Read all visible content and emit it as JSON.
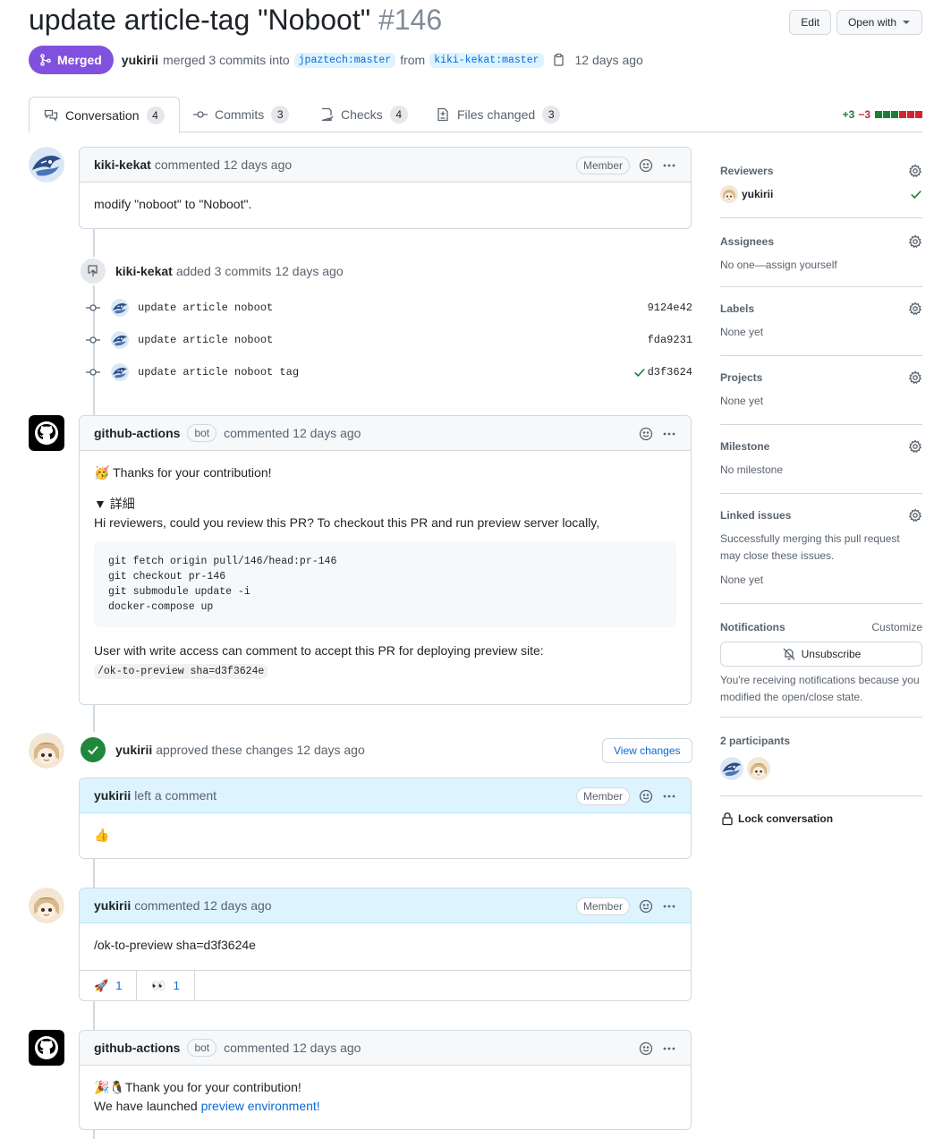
{
  "pr": {
    "title": "update article-tag \"Noboot\"",
    "number": "#146",
    "edit_label": "Edit",
    "open_with_label": "Open with",
    "state_label": "Merged",
    "merged_by": "yukirii",
    "merged_text": "merged 3 commits into",
    "base_branch": "jpaztech:master",
    "from_text": "from",
    "head_branch": "kiki-kekat:master",
    "merged_time": "12 days ago"
  },
  "tabs": [
    {
      "label": "Conversation",
      "count": "4"
    },
    {
      "label": "Commits",
      "count": "3"
    },
    {
      "label": "Checks",
      "count": "4"
    },
    {
      "label": "Files changed",
      "count": "3"
    }
  ],
  "diffstat": {
    "additions": "+3",
    "deletions": "−3"
  },
  "comment1": {
    "author": "kiki-kekat",
    "meta": "commented 12 days ago",
    "badge": "Member",
    "body": "modify \"noboot\" to \"Noboot\"."
  },
  "commits_event": {
    "author": "kiki-kekat",
    "text": "added 3 commits 12 days ago",
    "commits": [
      {
        "message": "update article noboot",
        "sha": "9124e42"
      },
      {
        "message": "update article noboot",
        "sha": "fda9231"
      },
      {
        "message": "update article noboot tag",
        "sha": "d3f3624"
      }
    ]
  },
  "comment2": {
    "author": "github-actions",
    "bot": "bot",
    "meta": "commented 12 days ago",
    "thanks": "Thanks for your contribution!",
    "details": "▼ 詳細",
    "intro": "Hi reviewers, could you review this PR? To checkout this PR and run preview server locally,",
    "code": "git fetch origin pull/146/head:pr-146\ngit checkout pr-146\ngit submodule update -i\ndocker-compose up",
    "access_text": "User with write access can comment to accept this PR for deploying preview site:",
    "command": "/ok-to-preview sha=d3f3624e"
  },
  "review": {
    "author": "yukirii",
    "text": "approved these changes 12 days ago",
    "view_changes": "View changes",
    "inner_author": "yukirii",
    "inner_meta": "left a comment",
    "badge": "Member",
    "body": "👍"
  },
  "comment3": {
    "author": "yukirii",
    "meta": "commented 12 days ago",
    "badge": "Member",
    "body": "/ok-to-preview sha=d3f3624e",
    "reactions": [
      {
        "emoji": "🚀",
        "count": "1"
      },
      {
        "emoji": "👀",
        "count": "1"
      }
    ]
  },
  "comment4": {
    "author": "github-actions",
    "bot": "bot",
    "meta": "commented 12 days ago",
    "line1": "Thank you for your contribution!",
    "line2": "We have launched",
    "link": "preview environment!"
  },
  "sidebar": {
    "reviewers": {
      "title": "Reviewers",
      "name": "yukirii"
    },
    "assignees": {
      "title": "Assignees",
      "value": "No one—assign yourself"
    },
    "labels": {
      "title": "Labels",
      "value": "None yet"
    },
    "projects": {
      "title": "Projects",
      "value": "None yet"
    },
    "milestone": {
      "title": "Milestone",
      "value": "No milestone"
    },
    "linked": {
      "title": "Linked issues",
      "value": "Successfully merging this pull request may close these issues.",
      "value2": "None yet"
    },
    "notifications": {
      "title": "Notifications",
      "customize": "Customize",
      "button": "Unsubscribe",
      "reason": "You're receiving notifications because you modified the open/close state."
    },
    "participants": {
      "title": "2 participants"
    },
    "lock": "Lock conversation"
  },
  "colors": {
    "merged": "#8250df",
    "success": "#1a7f37",
    "danger": "#d1242f",
    "link": "#0969da"
  }
}
